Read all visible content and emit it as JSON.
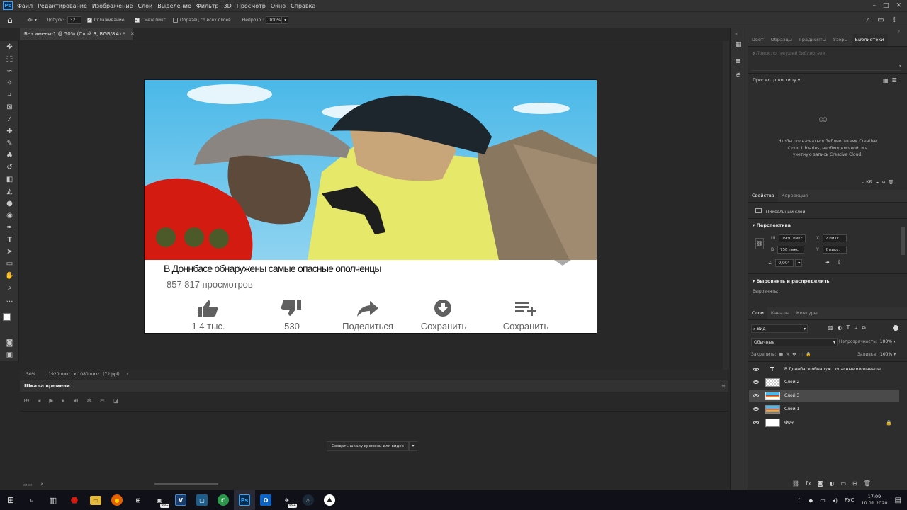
{
  "menu": {
    "logo": "Ps",
    "items": [
      "Файл",
      "Редактирование",
      "Изображение",
      "Слои",
      "Выделение",
      "Фильтр",
      "3D",
      "Просмотр",
      "Окно",
      "Справка"
    ]
  },
  "options": {
    "tolerance_label": "Допуск:",
    "tolerance_value": "32",
    "antialias_label": "Сглаживание",
    "contiguous_label": "Смеж.пикс",
    "sample_all_label": "Образец со всех слоев",
    "opacity_label": "Непрозр.:",
    "opacity_value": "100%"
  },
  "document": {
    "tab_title": "Без имени-1 @ 50% (Слой 3, RGB/8#) *",
    "zoom": "50%",
    "size_info": "1920 пикс. x 1080 пикс. (72 ppi)"
  },
  "image": {
    "headline": "В Доннбасе обнаружены самые опасные ополченцы",
    "views": "857 817 просмотров",
    "actions": [
      {
        "icon": "thumbs-up-icon",
        "label": "1,4 тыс."
      },
      {
        "icon": "thumbs-down-icon",
        "label": "530"
      },
      {
        "icon": "share-icon",
        "label": "Поделиться"
      },
      {
        "icon": "download-icon",
        "label": "Сохранить"
      },
      {
        "icon": "playlist-add-icon",
        "label": "Сохранить"
      }
    ]
  },
  "timeline": {
    "title": "Шкала времени",
    "create_button": "Создать шкалу времени для видео"
  },
  "libraries": {
    "tabs": [
      "Цвет",
      "Образцы",
      "Градиенты",
      "Узоры",
      "Библиотеки"
    ],
    "active_tab": "Библиотеки",
    "search_placeholder": "Поиск по текущей библиотеке",
    "view_by": "Просмотр по типу",
    "message": "Чтобы пользоваться библиотеками Creative Cloud Libraries, необходимо войти в учетную запись Creative Cloud.",
    "kb": "-- КБ"
  },
  "properties": {
    "tabs": [
      "Свойства",
      "Коррекция"
    ],
    "layer_type": "Пиксельный слой",
    "section_transform": "Перспектива",
    "w_label": "Ш",
    "w_value": "1930 пикс.",
    "h_label": "В",
    "h_value": "758 пикс.",
    "x_label": "X",
    "x_value": "2 пикс.",
    "y_label": "Y",
    "y_value": "2 пикс.",
    "angle": "0,00°",
    "section_align": "Выровнять и распределить",
    "align_sub": "Выровнять:"
  },
  "layers": {
    "tabs": [
      "Слои",
      "Каналы",
      "Контуры"
    ],
    "filter": "Вид",
    "blend_mode": "Обычные",
    "opacity_label": "Непрозрачность:",
    "opacity_value": "100%",
    "lock_label": "Закрепить:",
    "fill_label": "Заливка:",
    "fill_value": "100%",
    "items": [
      {
        "name": "В Доннбасе обнаруж...опасные ополченцы",
        "kind": "text"
      },
      {
        "name": "Слой 2",
        "kind": "empty"
      },
      {
        "name": "Слой 3",
        "kind": "image",
        "selected": true
      },
      {
        "name": "Слой 1",
        "kind": "image"
      },
      {
        "name": "Фон",
        "kind": "white",
        "locked": true
      }
    ]
  },
  "taskbar": {
    "lang": "РУС",
    "time": "17:09",
    "date": "10.01.2020",
    "badge": "99+"
  },
  "colors": {
    "accent": "#31a8ff",
    "panel": "#323232",
    "background": "#282828"
  }
}
